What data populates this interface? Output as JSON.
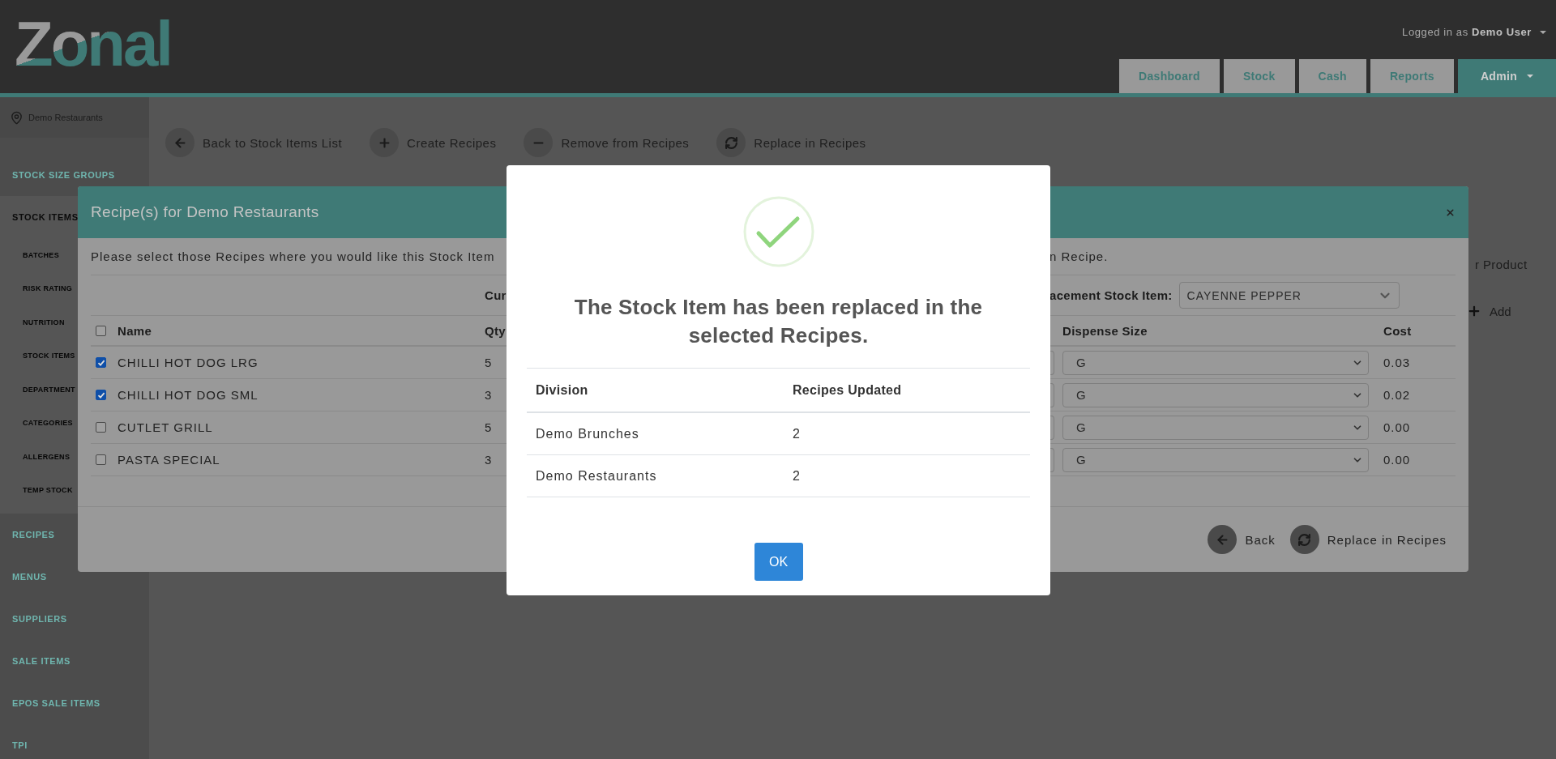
{
  "header": {
    "logo": "Zonal",
    "user_prefix": "Logged in as",
    "user_name": "Demo User",
    "tabs": [
      {
        "label": "Dashboard",
        "selected": false
      },
      {
        "label": "Stock",
        "selected": false
      },
      {
        "label": "Cash",
        "selected": false
      },
      {
        "label": "Reports",
        "selected": false
      },
      {
        "label": "Admin",
        "selected": true
      }
    ]
  },
  "sidebar": {
    "location": "Demo Restaurants",
    "items": [
      {
        "label": "STOCK SIZE GROUPS",
        "selected": false
      },
      {
        "label": "STOCK ITEMS",
        "selected": true,
        "children": [
          {
            "label": "BATCHES"
          },
          {
            "label": "RISK RATING"
          },
          {
            "label": "NUTRITION"
          },
          {
            "label": "STOCK ITEMS"
          },
          {
            "label": "DEPARTMENT"
          },
          {
            "label": "CATEGORIES"
          },
          {
            "label": "ALLERGENS"
          },
          {
            "label": "TEMP STOCK"
          }
        ]
      },
      {
        "label": "RECIPES",
        "selected": false
      },
      {
        "label": "MENUS",
        "selected": false
      },
      {
        "label": "SUPPLIERS",
        "selected": false
      },
      {
        "label": "SALE ITEMS",
        "selected": false
      },
      {
        "label": "EPOS SALE ITEMS",
        "selected": false
      },
      {
        "label": "TPI",
        "selected": false
      }
    ]
  },
  "toolbar": [
    {
      "kind": "back",
      "label": "Back to Stock Items List"
    },
    {
      "kind": "plus",
      "label": "Create Recipes"
    },
    {
      "kind": "minus",
      "label": "Remove from Recipes"
    },
    {
      "kind": "refresh",
      "label": "Replace in Recipes"
    }
  ],
  "page_right": {
    "text": "r Product",
    "add_label": "Add"
  },
  "recipe_modal": {
    "title": "Recipe(s) for Demo Restaurants",
    "instruction_left": "Please select those Recipes where you would like this Stock Item",
    "instruction_right": "n Recipe.",
    "current_label": "Cur",
    "replacement_label": "acement Stock Item:",
    "replacement_value": "CAYENNE PEPPER",
    "select_all_checked": false,
    "columns": {
      "name": "Name",
      "qty": "Qty",
      "dispense": "Dispense Size",
      "cost": "Cost"
    },
    "rows": [
      {
        "checked": true,
        "name": "CHILLI HOT DOG LRG",
        "qty": "5",
        "dispense": "G",
        "cost": "0.03"
      },
      {
        "checked": true,
        "name": "CHILLI HOT DOG SML",
        "qty": "3",
        "dispense": "G",
        "cost": "0.02"
      },
      {
        "checked": false,
        "name": "CUTLET GRILL",
        "qty": "5",
        "dispense": "G",
        "cost": "0.00"
      },
      {
        "checked": false,
        "name": "PASTA SPECIAL",
        "qty": "3",
        "dispense": "G",
        "cost": "0.00"
      }
    ],
    "buttons": [
      {
        "kind": "back",
        "label": "Back"
      },
      {
        "kind": "refresh",
        "label": "Replace in Recipes"
      }
    ]
  },
  "dialog": {
    "message": "The Stock Item has been replaced in the selected Recipes.",
    "columns": [
      "Division",
      "Recipes Updated"
    ],
    "rows": [
      [
        "Demo Brunches",
        "2"
      ],
      [
        "Demo Restaurants",
        "2"
      ]
    ],
    "ok": "OK"
  }
}
